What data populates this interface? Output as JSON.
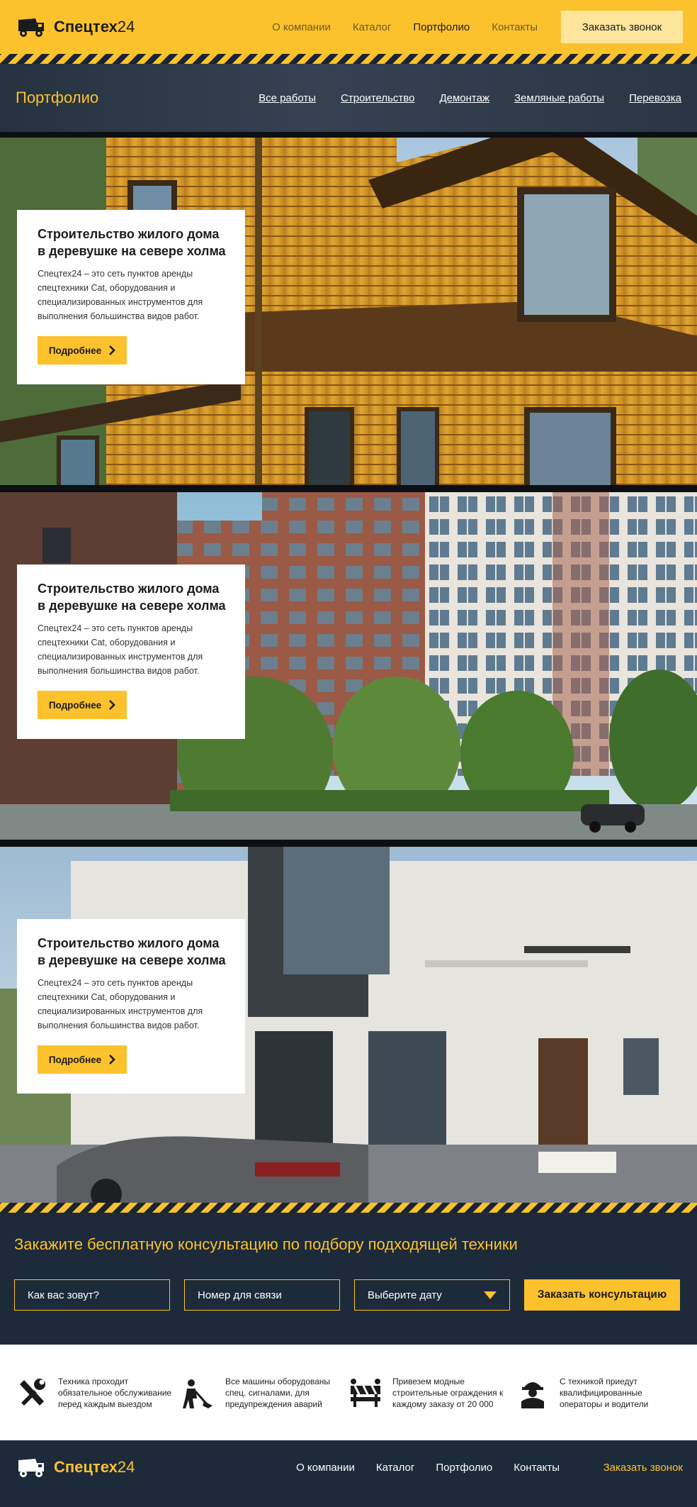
{
  "brand": {
    "name": "Спецтех",
    "num": "24"
  },
  "nav": [
    "О компании",
    "Каталог",
    "Портфолио",
    "Контакты"
  ],
  "header_cta": "Заказать звонок",
  "portfolio": {
    "title": "Портфолио",
    "filters": [
      "Все работы",
      "Строительство",
      "Демонтаж",
      "Земляные работы",
      "Перевозка"
    ]
  },
  "projects": [
    {
      "title_line1": "Строительство жилого дома",
      "title_line2": "в деревушке на севере холма",
      "desc": "Спецтех24 – это сеть пунктов аренды спецтехники Cat, оборудования и специализированных инструментов для выполнения большинства видов работ.",
      "button": "Подробнее"
    },
    {
      "title_line1": "Строительство жилого дома",
      "title_line2": "в деревушке на севере холма",
      "desc": "Спецтех24 – это сеть пунктов аренды спецтехники Cat, оборудования и специализированных инструментов для выполнения большинства видов работ.",
      "button": "Подробнее"
    },
    {
      "title_line1": "Строительство жилого дома",
      "title_line2": "в деревушке на севере холма",
      "desc": "Спецтех24 – это сеть пунктов аренды спецтехники Cat, оборудования и специализированных инструментов для выполнения большинства видов работ.",
      "button": "Подробнее"
    }
  ],
  "consult": {
    "title": "Закажите бесплатную консультацию по подбору подходящей техники",
    "name_placeholder": "Как вас зовут?",
    "phone_placeholder": "Номер для связи",
    "date_placeholder": "Выберите дату",
    "button": "Заказать консультацию"
  },
  "features": [
    {
      "icon": "tools-icon",
      "text": "Техника проходит обязательное обслуживание перед каждым выездом"
    },
    {
      "icon": "worker-shovel-icon",
      "text": "Все машины оборудованы спец. сигналами, для предупреждения аварий"
    },
    {
      "icon": "barrier-icon",
      "text": "Привезем модные строительные ограждения к каждому заказу от 20 000"
    },
    {
      "icon": "helmet-worker-icon",
      "text": "С техникой приедут квалифицированные операторы и водители"
    }
  ],
  "footer": {
    "nav": [
      "О компании",
      "Каталог",
      "Портфолио",
      "Контакты"
    ],
    "cta": "Заказать звонок"
  },
  "colors": {
    "accent": "#fcc22d",
    "dark": "#1d2a39"
  }
}
